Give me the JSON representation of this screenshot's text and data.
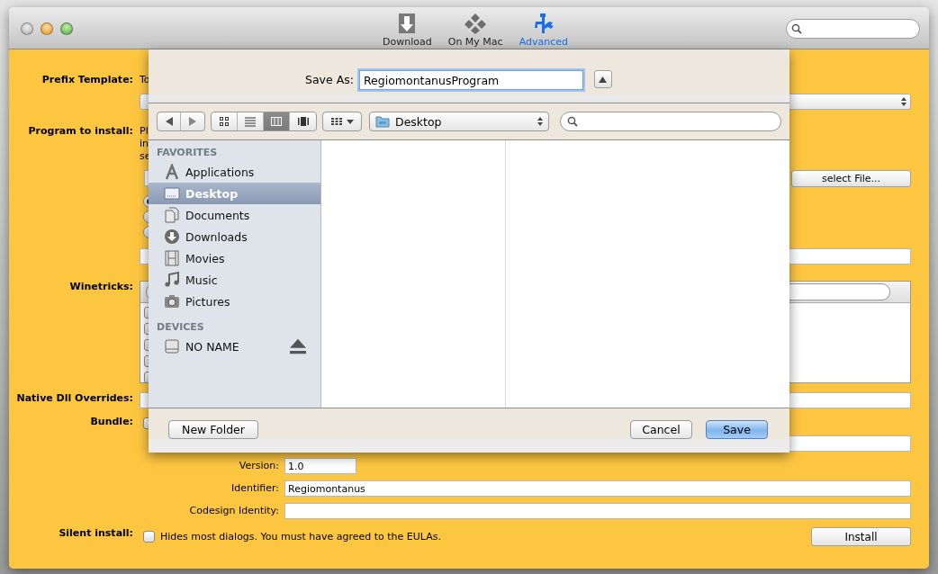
{
  "window": {
    "toolbar": [
      {
        "label": "Download",
        "kind": "download",
        "selected": false
      },
      {
        "label": "On My Mac",
        "kind": "mac",
        "selected": false
      },
      {
        "label": "Advanced",
        "kind": "advanced",
        "selected": true
      }
    ]
  },
  "form": {
    "prefix_template": {
      "label": "Prefix Template:",
      "note": "To"
    },
    "program": {
      "label": "Program to install:",
      "note_lines": [
        "Pl",
        "in",
        "se"
      ],
      "button": "select File...",
      "options": [
        {
          "selected": true
        },
        {
          "selected": false
        },
        {
          "selected": false
        }
      ]
    },
    "winetricks": {
      "label": "Winetricks:",
      "items": [
        {
          "checked": false
        },
        {
          "checked": false
        },
        {
          "checked": false
        },
        {
          "checked": false
        },
        {
          "checked": false
        }
      ]
    },
    "dll_overrides": {
      "label": "Native Dll Overrides:"
    },
    "bundle": {
      "label": "Bundle:",
      "checked": false
    },
    "version": {
      "label": "Version:",
      "value": "1.0"
    },
    "identifier": {
      "label": "Identifier:",
      "value": "Regiomontanus"
    },
    "codesign": {
      "label": "Codesign Identity:"
    },
    "silent_install": {
      "label": "Silent install:",
      "checked": false,
      "text": "Hides most dialogs. You must have agreed to the EULAs."
    },
    "install_button": "Install"
  },
  "save_dialog": {
    "save_as": {
      "label": "Save As:",
      "value": "RegiomontanusProgram"
    },
    "view_modes": [
      {
        "kind": "icons",
        "selected": false
      },
      {
        "kind": "list",
        "selected": false
      },
      {
        "kind": "columns",
        "selected": true
      },
      {
        "kind": "coverflow",
        "selected": false
      }
    ],
    "location": "Desktop",
    "sidebar": [
      {
        "heading": "FAVORITES",
        "items": [
          {
            "label": "Applications",
            "kind": "applications",
            "selected": false
          },
          {
            "label": "Desktop",
            "kind": "desktop",
            "selected": true
          },
          {
            "label": "Documents",
            "kind": "documents",
            "selected": false
          },
          {
            "label": "Downloads",
            "kind": "downloads",
            "selected": false
          },
          {
            "label": "Movies",
            "kind": "movies",
            "selected": false
          },
          {
            "label": "Music",
            "kind": "music",
            "selected": false
          },
          {
            "label": "Pictures",
            "kind": "pictures",
            "selected": false
          }
        ]
      },
      {
        "heading": "DEVICES",
        "items": [
          {
            "label": "NO NAME",
            "kind": "drive",
            "selected": false,
            "ejectable": true
          }
        ]
      }
    ],
    "buttons": [
      {
        "label": "New Folder",
        "kind": "secondary"
      },
      {
        "label": "Cancel",
        "kind": "normal"
      },
      {
        "label": "Save",
        "kind": "default"
      }
    ]
  }
}
